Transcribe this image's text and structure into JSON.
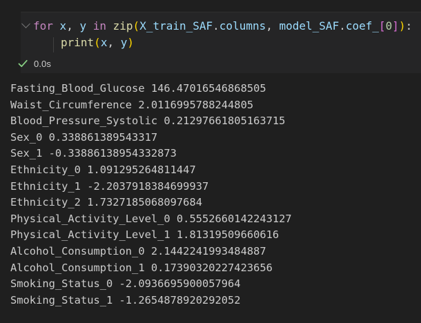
{
  "editor": {
    "line1": [
      {
        "text": "for",
        "cls": "kw"
      },
      {
        "text": " ",
        "cls": "punc"
      },
      {
        "text": "x",
        "cls": "var"
      },
      {
        "text": ", ",
        "cls": "punc"
      },
      {
        "text": "y",
        "cls": "var"
      },
      {
        "text": " ",
        "cls": "punc"
      },
      {
        "text": "in",
        "cls": "kw"
      },
      {
        "text": " ",
        "cls": "punc"
      },
      {
        "text": "zip",
        "cls": "fn"
      },
      {
        "text": "(",
        "cls": "br1"
      },
      {
        "text": "X_train_SAF",
        "cls": "var"
      },
      {
        "text": ".",
        "cls": "punc"
      },
      {
        "text": "columns",
        "cls": "var"
      },
      {
        "text": ", ",
        "cls": "punc"
      },
      {
        "text": "model_SAF",
        "cls": "var"
      },
      {
        "text": ".",
        "cls": "punc"
      },
      {
        "text": "coef_",
        "cls": "var"
      },
      {
        "text": "[",
        "cls": "br2"
      },
      {
        "text": "0",
        "cls": "num"
      },
      {
        "text": "]",
        "cls": "br2"
      },
      {
        "text": ")",
        "cls": "br1"
      },
      {
        "text": ":",
        "cls": "punc"
      }
    ],
    "line2": [
      {
        "text": "print",
        "cls": "fn"
      },
      {
        "text": "(",
        "cls": "br1"
      },
      {
        "text": "x",
        "cls": "var"
      },
      {
        "text": ", ",
        "cls": "punc"
      },
      {
        "text": "y",
        "cls": "var"
      },
      {
        "text": ")",
        "cls": "br1"
      }
    ]
  },
  "status": {
    "icon": "check-icon",
    "icon_color": "#89d185",
    "duration": "0.0s"
  },
  "output": [
    "Fasting_Blood_Glucose 146.47016546868505",
    "Waist_Circumference 2.0116995788244805",
    "Blood_Pressure_Systolic 0.21297661805163715",
    "Sex_0 0.338861389543317",
    "Sex_1 -0.33886138954332873",
    "Ethnicity_0 1.091295264811447",
    "Ethnicity_1 -2.2037918384699937",
    "Ethnicity_2 1.7327185068097684",
    "Physical_Activity_Level_0 0.5552660142243127",
    "Physical_Activity_Level_1 1.81319509660616",
    "Alcohol_Consumption_0 2.1442241993484887",
    "Alcohol_Consumption_1 0.17390320227423656",
    "Smoking_Status_0 -2.0936695900057964",
    "Smoking_Status_1 -1.2654878920292052"
  ]
}
